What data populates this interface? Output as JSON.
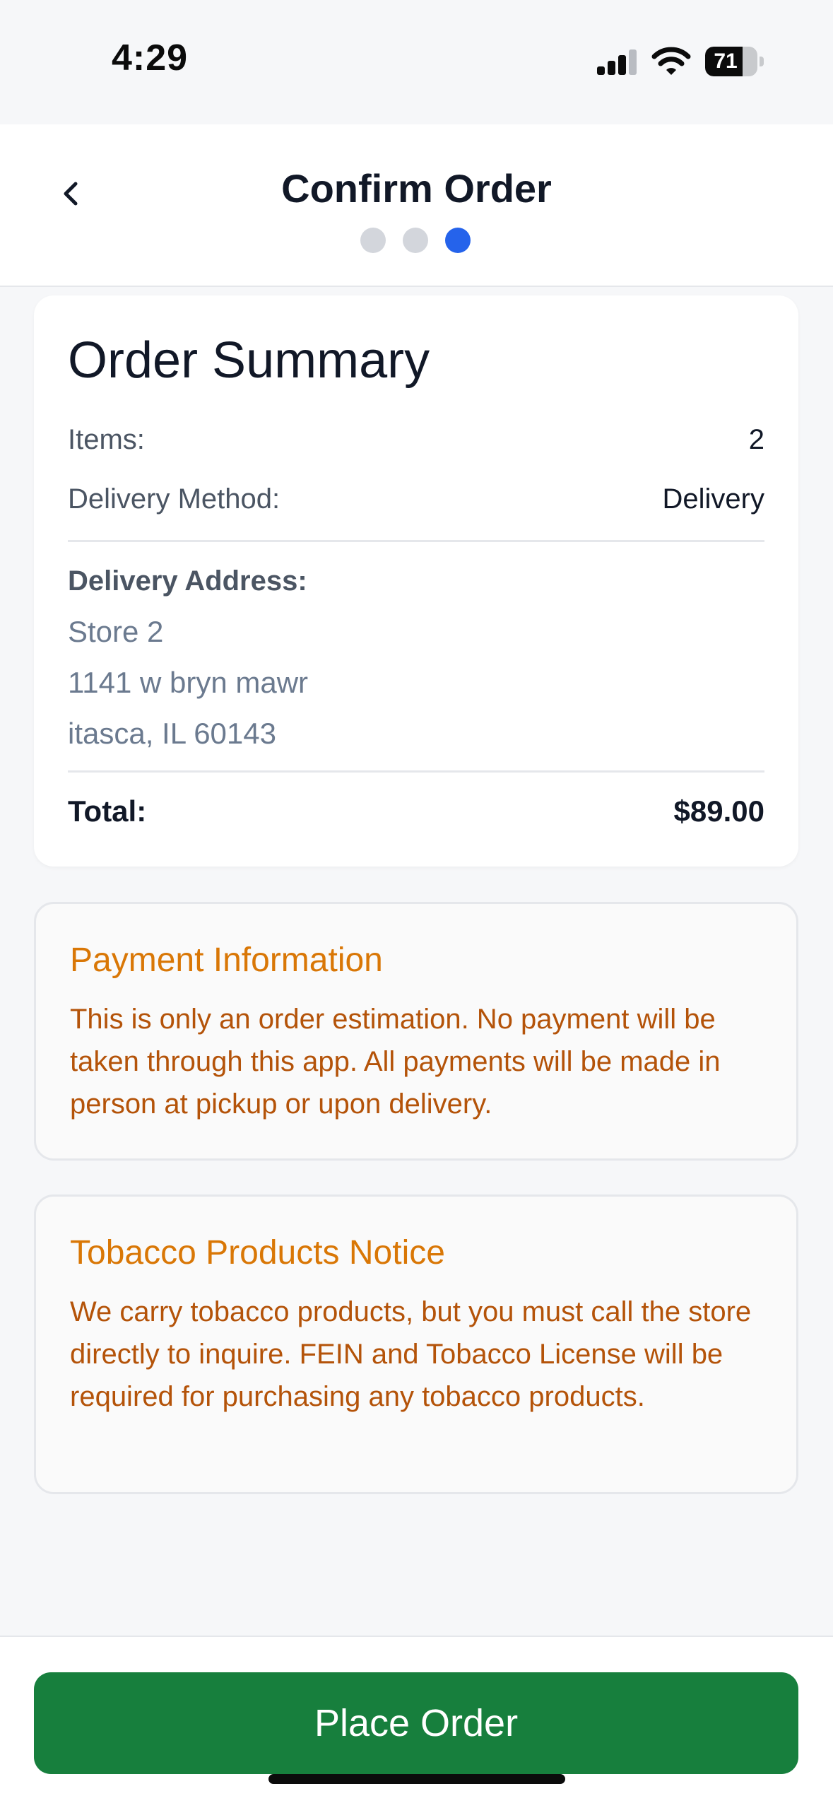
{
  "status_bar": {
    "time": "4:29",
    "battery": "71",
    "battery_level": 0.71
  },
  "header": {
    "title": "Confirm Order",
    "steps_total": 3,
    "active_step": 3
  },
  "summary": {
    "title": "Order Summary",
    "items_label": "Items:",
    "items_value": "2",
    "method_label": "Delivery Method:",
    "method_value": "Delivery",
    "address_label": "Delivery Address:",
    "address_lines": [
      "Store 2",
      "1141 w bryn mawr",
      "itasca, IL 60143"
    ],
    "total_label": "Total:",
    "total_value": "$89.00"
  },
  "payment": {
    "title": "Payment Information",
    "body": "This is only an order estimation. No payment will be taken through this app. All payments will be made in person at pickup or upon delivery."
  },
  "tobacco": {
    "title": "Tobacco Products Notice",
    "body": "We carry tobacco products, but you must call the store directly to inquire. FEIN and Tobacco License will be required for purchasing any tobacco products."
  },
  "actions": {
    "place_order": "Place Order"
  },
  "colors": {
    "accent": "#2563eb",
    "primary_button": "#177f3d",
    "notice_title": "#d97706",
    "notice_text": "#b45309"
  },
  "icons": {
    "back": "chevron-left-icon",
    "signal": "cellular-signal-icon",
    "wifi": "wifi-icon",
    "battery": "battery-icon"
  }
}
